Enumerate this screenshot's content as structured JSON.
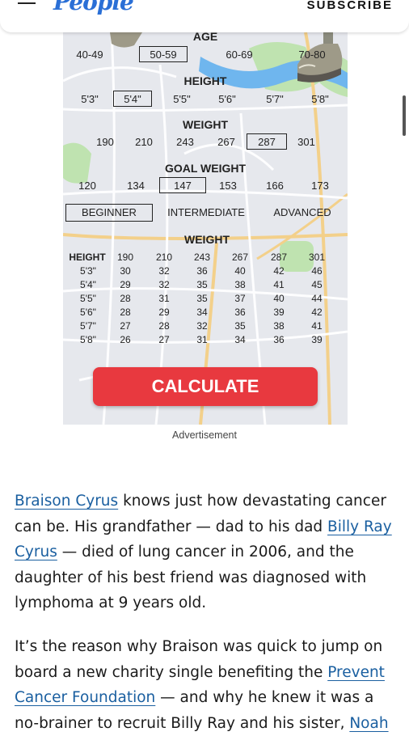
{
  "header": {
    "logo": "People",
    "subscribe_label": "SUBSCRIBE"
  },
  "ad": {
    "age": {
      "heading": "AGE",
      "options": [
        "40-49",
        "50-59",
        "60-69",
        "70-80"
      ],
      "selected": "50-59"
    },
    "height": {
      "heading": "HEIGHT",
      "options": [
        "5'3\"",
        "5'4\"",
        "5'5\"",
        "5'6\"",
        "5'7\"",
        "5'8\""
      ],
      "selected": "5'4\""
    },
    "weight": {
      "heading": "WEIGHT",
      "options": [
        "190",
        "210",
        "243",
        "267",
        "287",
        "301"
      ],
      "selected": "287"
    },
    "goal_weight": {
      "heading": "GOAL WEIGHT",
      "options": [
        "120",
        "134",
        "147",
        "153",
        "166",
        "173"
      ],
      "selected": "147"
    },
    "level": {
      "options": [
        "BEGINNER",
        "INTERMEDIATE",
        "ADVANCED"
      ],
      "selected": "BEGINNER"
    },
    "table": {
      "heading": "WEIGHT",
      "corner": "HEIGHT",
      "columns": [
        "190",
        "210",
        "243",
        "267",
        "287",
        "301"
      ],
      "rows": [
        {
          "label": "5'3\"",
          "values": [
            "30",
            "32",
            "36",
            "40",
            "42",
            "46"
          ]
        },
        {
          "label": "5'4\"",
          "values": [
            "29",
            "32",
            "35",
            "38",
            "41",
            "45"
          ]
        },
        {
          "label": "5'5\"",
          "values": [
            "28",
            "31",
            "35",
            "37",
            "40",
            "44"
          ]
        },
        {
          "label": "5'6\"",
          "values": [
            "28",
            "29",
            "34",
            "36",
            "39",
            "42"
          ]
        },
        {
          "label": "5'7\"",
          "values": [
            "27",
            "28",
            "32",
            "35",
            "38",
            "41"
          ]
        },
        {
          "label": "5'8\"",
          "values": [
            "26",
            "27",
            "31",
            "34",
            "36",
            "39"
          ]
        }
      ]
    },
    "calculate_label": "CALCULATE"
  },
  "ad_label": "Advertisement",
  "article": {
    "p1": {
      "link1": "Braison Cyrus",
      "t1": " knows just how devastating cancer can be. His grandfather — dad to his dad ",
      "link2": "Billy Ray Cyrus",
      "t2": " — died of lung cancer in 2006, and the daughter of his best friend was diagnosed with lymphoma at 9 years old."
    },
    "p2": {
      "t1": "It’s the reason why Braison was quick to jump on board a new charity single benefiting the ",
      "link1": "Prevent Cancer Foundation",
      "t2": " — and why he knew it was a no-brainer to recruit Billy Ray and his sister, ",
      "link2": "Noah"
    }
  },
  "colors": {
    "link": "#1a5fa0",
    "calculate_button": "#e8393f",
    "logo": "#2a6fd6"
  }
}
